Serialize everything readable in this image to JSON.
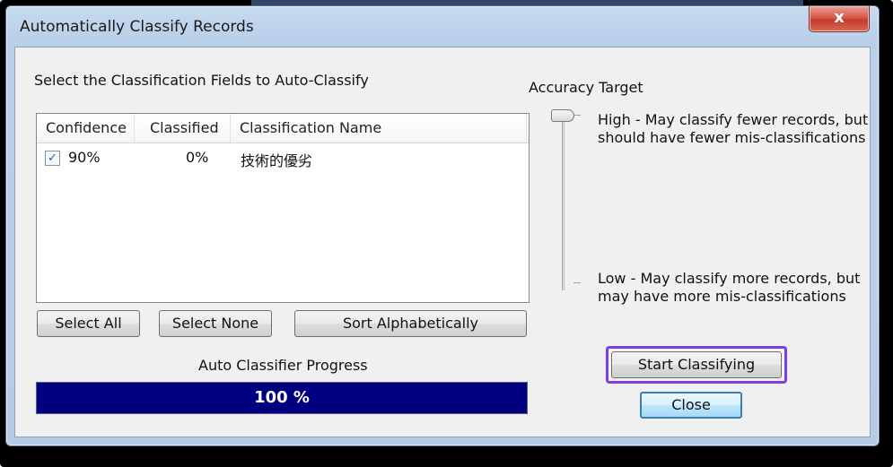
{
  "dialog": {
    "title": "Automatically Classify Records",
    "close_glyph": "x"
  },
  "fields": {
    "heading": "Select the Classification Fields to Auto-Classify",
    "columns": [
      "Confidence",
      "Classified",
      "Classification Name"
    ],
    "rows": [
      {
        "checked": true,
        "confidence": "90%",
        "classified": "0%",
        "name": "技術的優劣"
      }
    ]
  },
  "buttons": {
    "select_all": "Select All",
    "select_none": "Select None",
    "sort_alpha": "Sort Alphabetically",
    "start": "Start Classifying",
    "close": "Close"
  },
  "progress": {
    "label": "Auto Classifier Progress",
    "value": 1.0,
    "text": "100 %"
  },
  "accuracy": {
    "heading": "Accuracy Target",
    "level": 1.0,
    "high_line1": "High - May classify fewer records, but",
    "high_line2": "should have fewer mis-classifications",
    "low_line1": "Low - May classify more records, but",
    "low_line2": "may have more mis-classifications"
  },
  "colors": {
    "progress_bar": "#000080",
    "highlight": "#7b3fe4",
    "close_button": "#c33a2a"
  },
  "icons": {
    "check": "✓",
    "close": "x"
  }
}
